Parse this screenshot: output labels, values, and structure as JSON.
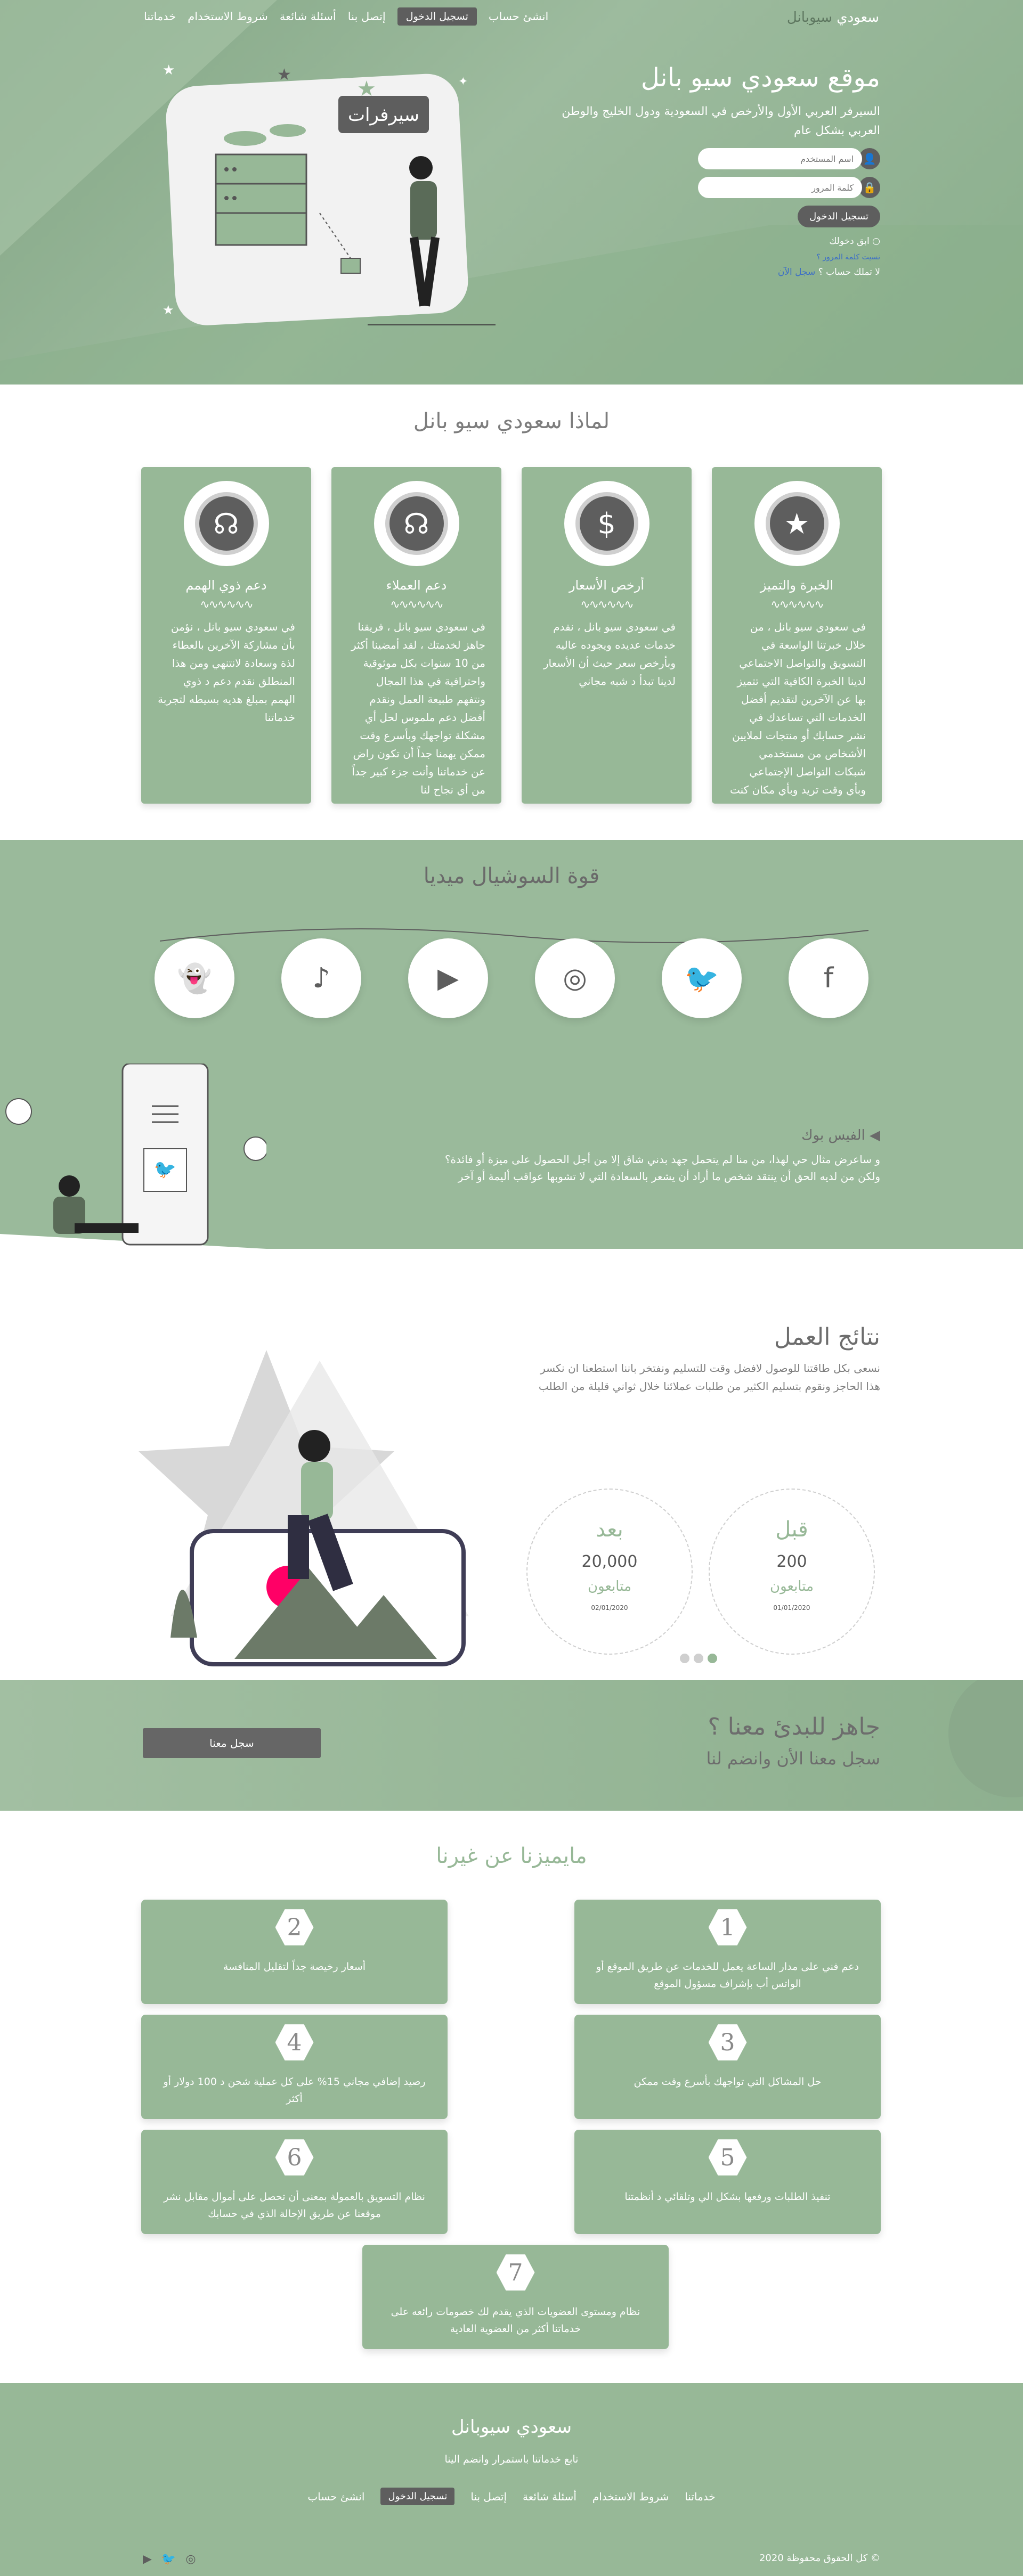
{
  "nav": {
    "logo_prefix": "سعودي",
    "logo_suffix": "سيوبانل",
    "items": [
      "خدماتنا",
      "شروط الاستخدام",
      "أسئلة شائعة",
      "إتصل بنا"
    ],
    "login": "تسجيل الدخول",
    "signup": "انشئ حساب"
  },
  "hero": {
    "title_a": "موقع",
    "title_b": "سعودي سيو بانل",
    "desc": "السيرفر العربي الأول والأرخص في السعودية ودول الخليج والوطن العربي بشكل عام",
    "username_ph": "اسم المستخدم",
    "password_ph": "كلمة المرور",
    "login_btn": "تسجيل الدخول",
    "remember": "ابق دخولك",
    "forgot": "نسيت كلمة المرور ؟",
    "no_account": "لا تملك حساب ؟",
    "register": "سجل الآن",
    "illus_label": "سيرفرات"
  },
  "why": {
    "title": "لماذا سعودي سيو بانل",
    "cards": [
      {
        "icon": "★",
        "title": "الخبرة والتميز",
        "text": "في سعودي سيو بانل ، من خلال خبرتنا الواسعة في التسويق والتواصل الاجتماعي لدينا الخبرة الكافية التي تتميز بها عن الآخرين لتقديم أفضل الخدمات التي تساعدك في نشر حسابك أو منتجات لملايين الأشخاص من مستخدمي شبكات التواصل الإجتماعي وبأي وقت تريد وبأي مكان كنت"
      },
      {
        "icon": "$",
        "title": "أرخص الأسعار",
        "text": "في سعودي سيو بانل ، نقدم خدمات عديده ويجوده عاليه وبأرخص سعر حيث أن الأسعار لدينا تبدأ د شبه مجاني"
      },
      {
        "icon": "☊",
        "title": "دعم العملاء",
        "text": "في سعودي سيو بانل ، فريقنا جاهز لخدمتك ، لقد أمضينا أكثر من 10 سنوات بكل موثوقية واحترافية في هذا المجال ونتفهم طبيعة العمل ونقدم أفضل دعم ملموس لحل أي مشكلة تواجهك وبأسرع وقت ممكن يهمنا جداً أن تكون راض عن خدماتنا وأنت جزء كبير جداً من أي نجاح لنا"
      },
      {
        "icon": "☊",
        "title": "دعم ذوي الهمم",
        "text": "في سعودي سيو بانل ، نؤمن بأن مشاركة الآخرين بالعطاء لذة وسعادة لانتنهي ومن هذا المنطلق نقدم دعم د ذوي الهمم بمبلغ هديه بسيطه لتجربة خدماتنا"
      }
    ]
  },
  "social": {
    "title": "قوة السوشيال ميديا",
    "icons": [
      "facebook-icon",
      "twitter-icon",
      "instagram-icon",
      "youtube-icon",
      "tiktok-icon",
      "snapchat-icon"
    ],
    "glyphs": [
      "f",
      "🐦",
      "◎",
      "▶",
      "♪",
      "👻"
    ],
    "fb_title": "الفيس بوك",
    "fb_text": "و ساعرض مثال حي لهذا، من منا لم يتحمل جهد بدني شاق إلا من أجل الحصول على ميزة أو فائدة؟ ولكن من لديه الحق أن ينتقد شخص ما أراد أن يشعر بالسعادة التي لا تشوبها عواقب أليمة أو آخر"
  },
  "results": {
    "title": "نتائج العمل",
    "desc": "نسعى بكل طاقتنا للوصول لافضل وقت للتسليم ونفتخر باننا استطعنا ان نكسر هذا الحاجز ونقوم بتسليم الكثير من طلبات عملائنا خلال ثواني قليلة من الطلب",
    "before": {
      "title": "قبل",
      "num": "200",
      "unit": "متابعون",
      "date": "01/01/2020"
    },
    "after": {
      "title": "بعد",
      "num": "20,000",
      "unit": "متابعون",
      "date": "02/01/2020"
    }
  },
  "cta": {
    "title": "جاهز للبدئ معنا ؟",
    "sub": "سجل معنا الأن وانضم لنا",
    "btn": "سجل معنا"
  },
  "features": {
    "title": "مايميزنا عن غيرنا",
    "items": [
      {
        "n": "1",
        "t": "دعم فني على مدار الساعة يعمل للخدمات عن طريق الموقع أو الواتس أب بإشراف مسؤول الموقع"
      },
      {
        "n": "2",
        "t": "أسعار رخيصة جداً لتقليل المنافسة"
      },
      {
        "n": "3",
        "t": "حل المشاكل التي تواجهك بأسرع وقت ممكن"
      },
      {
        "n": "4",
        "t": "رصيد إضافي مجاني 15% على كل عملية شحن د 100 دولار أو أكثر"
      },
      {
        "n": "5",
        "t": "تنفيذ الطلبات ورفعها بشكل الي وتلقائي د أنظمتنا"
      },
      {
        "n": "6",
        "t": "نظام التسويق بالعمولة بمعنى أن تحصل على أموال مقابل نشر موقعنا عن طريق الإحالة الذي في حسابك"
      },
      {
        "n": "7",
        "t": "نظام ومستوى العضويات الذي يقدم لك خصومات رائعه على خدماتنا أكثر من العضوية العادية"
      }
    ]
  },
  "footer": {
    "logo": "سعودي سيوبانل",
    "slogan": "تابع خدماتنا باستمرار وانضم الينا",
    "items": [
      "خدماتنا",
      "شروط الاستخدام",
      "أسئلة شائعة",
      "إتصل بنا"
    ],
    "login": "تسجيل الدخول",
    "signup": "انشئ حساب",
    "copyright": "© كل الحقوق محفوظة 2020",
    "social": [
      "youtube-icon",
      "twitter-icon",
      "instagram-icon"
    ],
    "social_glyphs": [
      "▶",
      "🐦",
      "◎"
    ]
  },
  "colors": {
    "accent": "#97b897",
    "dark": "#5e5e5e",
    "link": "#3b6ec7"
  }
}
